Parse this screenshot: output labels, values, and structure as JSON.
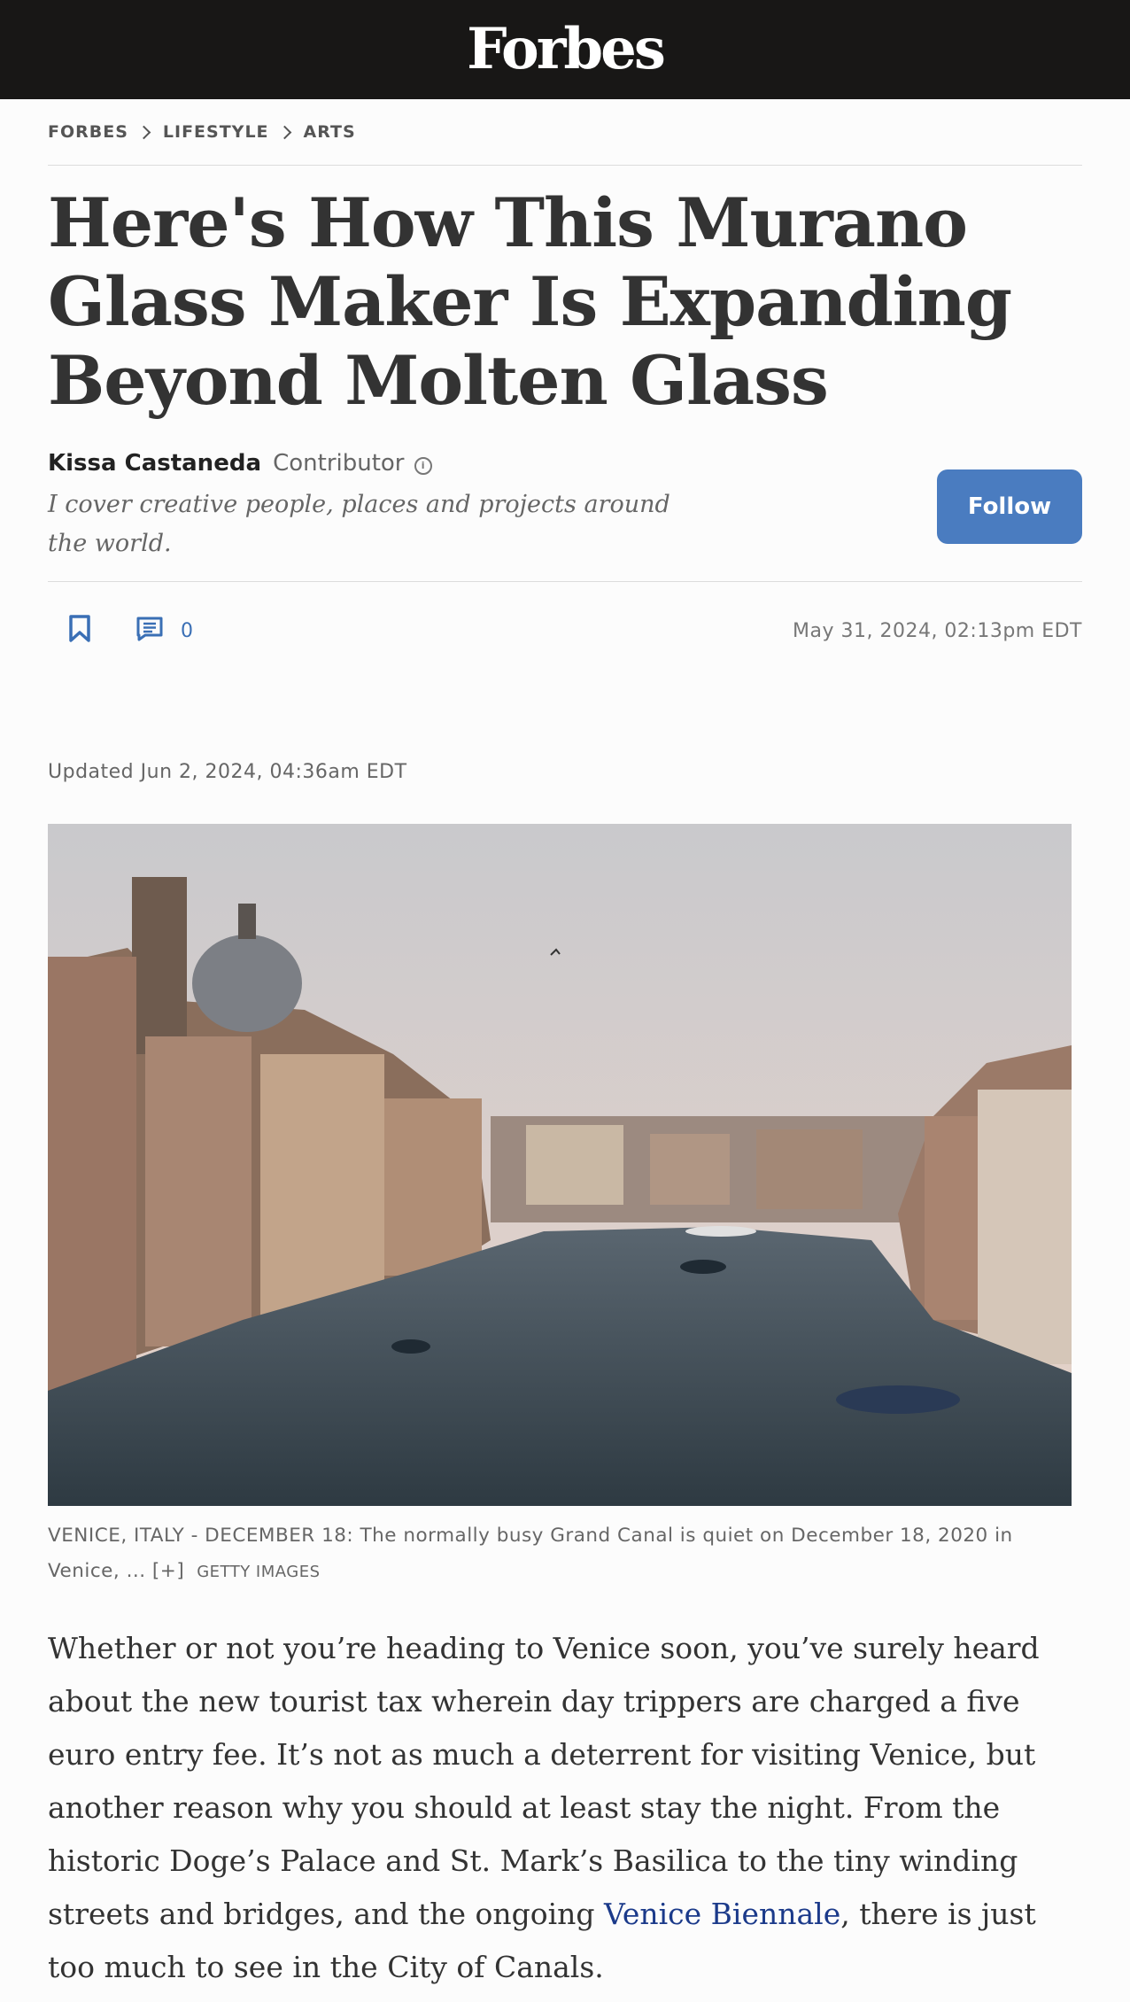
{
  "header": {
    "logo": "Forbes"
  },
  "breadcrumb": {
    "items": [
      "FORBES",
      "LIFESTYLE",
      "ARTS"
    ]
  },
  "article": {
    "title": "Here's How This Murano Glass Maker Is Expanding Beyond Molten Glass",
    "author": {
      "name": "Kissa Castaneda",
      "role": "Contributor",
      "bio": "I cover creative people, places and projects around the world."
    },
    "follow_label": "Follow",
    "comment_count": "0",
    "published": "May 31, 2024, 02:13pm EDT",
    "updated": "Updated Jun 2, 2024, 04:36am EDT",
    "image": {
      "caption": "VENICE, ITALY - DECEMBER 18: The normally busy Grand Canal is quiet on December 18, 2020 in Venice, ... [+]",
      "credit": "GETTY IMAGES"
    },
    "body": {
      "text_before_link": "Whether or not you’re heading to Venice soon, you’ve surely heard about the new tourist tax wherein day trippers are charged a five euro entry fee. It’s not as much a deterrent for visiting Venice, but another reason why you should at least stay the night. From the historic Doge’s Palace and St. Mark’s Basilica to the tiny winding streets and bridges, and the ongoing ",
      "link_text": "Venice Biennale",
      "text_after_link": ", there is just too much to see in the City of Canals."
    }
  },
  "colors": {
    "accent": "#4a7cc0",
    "link": "#1b3a8a",
    "topbar": "#181716"
  },
  "icons": {
    "bookmark": "bookmark-icon",
    "comment": "comment-icon",
    "info": "info-icon"
  }
}
